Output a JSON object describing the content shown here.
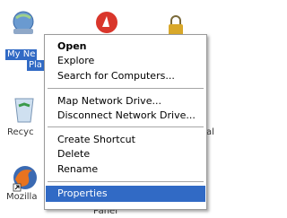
{
  "desktop": {
    "icons": [
      {
        "label_line1": "My Ne",
        "label_line2": "Pla",
        "icon": "my-network-places-icon"
      },
      {
        "label": "Recyc",
        "icon": "recycle-bin-icon"
      },
      {
        "label": "Mozilla",
        "icon": "mozilla-firefox-icon"
      },
      {
        "label": "Panel",
        "icon": "control-panel-icon"
      },
      {
        "label": "al",
        "icon": "partial-icon"
      }
    ]
  },
  "context_menu": {
    "items": [
      {
        "label": "Open"
      },
      {
        "label": "Explore"
      },
      {
        "label": "Search for Computers..."
      },
      {
        "label": "Map Network Drive..."
      },
      {
        "label": "Disconnect Network Drive..."
      },
      {
        "label": "Create Shortcut"
      },
      {
        "label": "Delete"
      },
      {
        "label": "Rename"
      },
      {
        "label": "Properties"
      }
    ]
  },
  "colors": {
    "highlight": "#316ac5",
    "menu_border": "#9a9a9a"
  }
}
